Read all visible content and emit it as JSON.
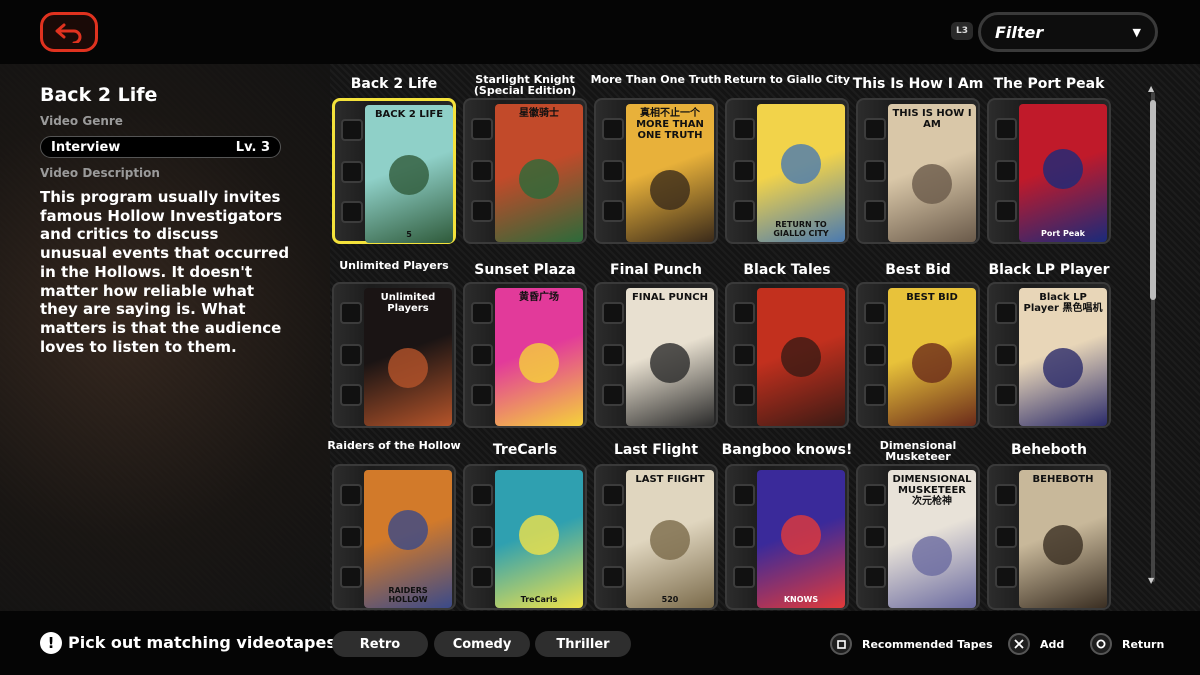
{
  "top": {
    "l3_label": "L3",
    "filter_label": "Filter"
  },
  "info": {
    "title": "Back 2 Life",
    "genre_label": "Video Genre",
    "genre": "Interview",
    "level": "Lv. 3",
    "desc_label": "Video Description",
    "description": "This program usually invites famous Hollow Investigators and critics to discuss unusual events that occurred in the Hollows. It doesn't matter how reliable what they are saying is. What matters is that the audience loves to listen to them."
  },
  "tapes": [
    {
      "title": "Back 2 Life",
      "size": "big",
      "cover_text": "BACK 2 LIFE",
      "cover_bot": "5",
      "color": "#8fd0c8",
      "accent": "#2f5a3a",
      "selected": true
    },
    {
      "title": "Starlight Knight (Special Edition)",
      "size": "small",
      "cover_text": "星徽骑士",
      "cover_bot": "",
      "color": "#c24a2a",
      "accent": "#2c6a3a",
      "selected": false
    },
    {
      "title": "More Than One Truth",
      "size": "small",
      "cover_text": "真相不止一个 MORE THAN ONE TRUTH",
      "cover_bot": "",
      "color": "#e8b13a",
      "accent": "#3a2a1a",
      "selected": false
    },
    {
      "title": "Return to Giallo City",
      "size": "small",
      "cover_text": "",
      "cover_bot": "RETURN TO GIALLO CITY",
      "color": "#f2d34a",
      "accent": "#4a7ab0",
      "selected": false
    },
    {
      "title": "This Is How I Am",
      "size": "big",
      "cover_text": "THIS IS HOW I AM",
      "cover_bot": "",
      "color": "#d9c7a8",
      "accent": "#6a5a4a",
      "selected": false
    },
    {
      "title": "The Port Peak",
      "size": "big",
      "cover_text": "",
      "cover_bot": "Port Peak",
      "color": "#c01a2a",
      "accent": "#1a2a7a",
      "selected": false
    },
    {
      "title": "Unlimited Players",
      "size": "small",
      "cover_text": "Unlimited Players",
      "cover_bot": "",
      "color": "#1a1414",
      "accent": "#b5542a",
      "selected": false
    },
    {
      "title": "Sunset Plaza",
      "size": "big",
      "cover_text": "黄昏广场",
      "cover_bot": "",
      "color": "#e23a9a",
      "accent": "#f5d23a",
      "selected": false
    },
    {
      "title": "Final Punch",
      "size": "big",
      "cover_text": "FINAL PUNCH",
      "cover_bot": "",
      "color": "#e8e0d0",
      "accent": "#2a2a2a",
      "selected": false
    },
    {
      "title": "Black Tales",
      "size": "big",
      "cover_text": "",
      "cover_bot": "",
      "color": "#c2301e",
      "accent": "#3a1a14",
      "selected": false
    },
    {
      "title": "Best Bid",
      "size": "big",
      "cover_text": "BEST BID",
      "cover_bot": "",
      "color": "#e8c23a",
      "accent": "#6a2a1a",
      "selected": false
    },
    {
      "title": "Black LP Player",
      "size": "big",
      "cover_text": "Black LP Player 黑色唱机",
      "cover_bot": "",
      "color": "#e8d6b8",
      "accent": "#2a2a6a",
      "selected": false
    },
    {
      "title": "Raiders of the Hollow",
      "size": "small",
      "cover_text": "",
      "cover_bot": "RAIDERS HOLLOW",
      "color": "#d27a2a",
      "accent": "#3a4a8a",
      "selected": false
    },
    {
      "title": "TreCarls",
      "size": "big",
      "cover_text": "",
      "cover_bot": "TreCarls",
      "color": "#2fa0b0",
      "accent": "#f0e24a",
      "selected": false
    },
    {
      "title": "Last Flight",
      "size": "big",
      "cover_text": "LAST FIIGHT",
      "cover_bot": "520",
      "color": "#e0d6bf",
      "accent": "#7a6a4a",
      "selected": false
    },
    {
      "title": "Bangboo knows!",
      "size": "big",
      "cover_text": "",
      "cover_bot": "KNOWS",
      "color": "#3a2a9a",
      "accent": "#e23a3a",
      "selected": false
    },
    {
      "title": "Dimensional Musketeer",
      "size": "small",
      "cover_text": "DIMENSIONAL MUSKETEER 次元枪神",
      "cover_bot": "",
      "color": "#e8e2d8",
      "accent": "#6a6aa0",
      "selected": false
    },
    {
      "title": "Beheboth",
      "size": "big",
      "cover_text": "BEHEBOTH",
      "cover_bot": "",
      "color": "#c8b89a",
      "accent": "#3a2e22",
      "selected": false
    }
  ],
  "bottom": {
    "hint_icon": "!",
    "hint": "Pick out matching videotapes",
    "tags": [
      "Retro",
      "Comedy",
      "Thriller"
    ],
    "prompts": [
      {
        "label": "Recommended Tapes",
        "icon": "square-button-icon"
      },
      {
        "label": "Add",
        "icon": "cross-button-icon"
      },
      {
        "label": "Return",
        "icon": "circle-button-icon"
      }
    ]
  }
}
